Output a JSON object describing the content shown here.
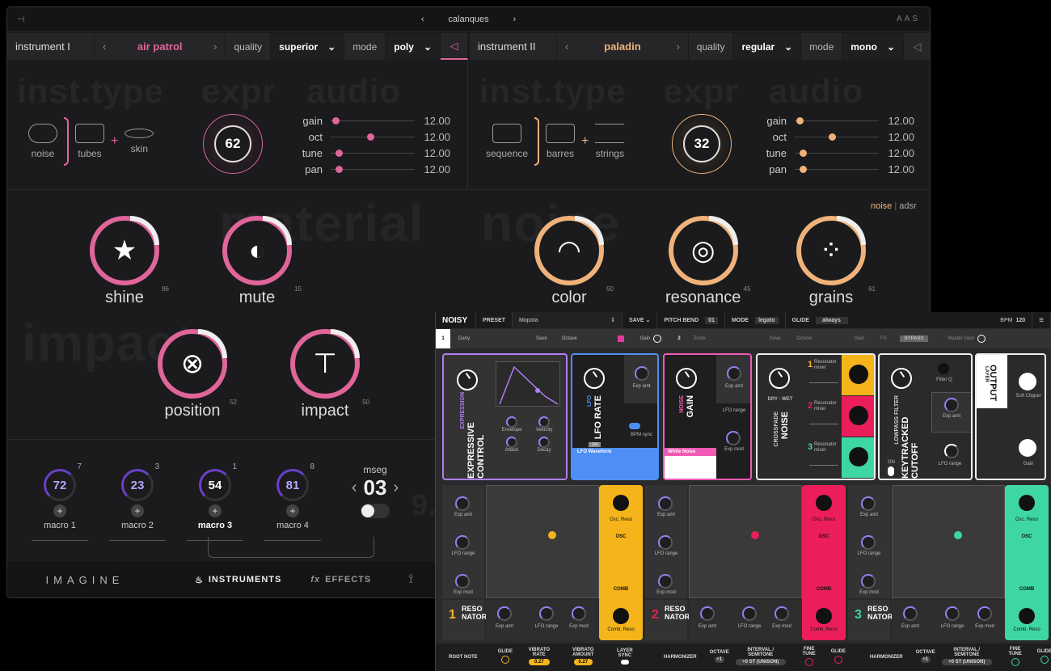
{
  "imagine": {
    "header": {
      "left_icon": "tune-icon",
      "prev": "‹",
      "preset_name": "calanques",
      "next": "›",
      "brand": "AAS"
    },
    "left": {
      "instrument": "instrument I",
      "preset": "air patrol",
      "quality_label": "quality",
      "quality": "superior",
      "mode_label": "mode",
      "mode": "poly",
      "accent": "#e0659a",
      "ghost": {
        "inst": "inst.type",
        "expr": "expr",
        "audio": "audio",
        "material": "material",
        "impact": "impact"
      },
      "types": [
        "noise",
        "tubes",
        "skin"
      ],
      "expr_value": "62",
      "sliders": [
        {
          "name": "gain",
          "value": "12.00",
          "pos": 0.02
        },
        {
          "name": "oct",
          "value": "12.00",
          "pos": 0.43
        },
        {
          "name": "tune",
          "value": "12.00",
          "pos": 0.06
        },
        {
          "name": "pan",
          "value": "12.00",
          "pos": 0.06
        }
      ],
      "knobs": [
        {
          "label": "shine",
          "num": "86",
          "icon": "star-icon",
          "glyph": "★"
        },
        {
          "label": "mute",
          "num": "15",
          "icon": "mute-circles-icon",
          "glyph": "◐"
        },
        {
          "label": "position",
          "num": "52",
          "icon": "drum-icon",
          "glyph": "⊗"
        },
        {
          "label": "impact",
          "num": "50",
          "icon": "mallet-icon",
          "glyph": "⊤"
        }
      ]
    },
    "right": {
      "instrument": "instrument II",
      "preset": "paladin",
      "quality_label": "quality",
      "quality": "regular",
      "mode_label": "mode",
      "mode": "mono",
      "accent": "#f0b27a",
      "ghost": {
        "inst": "inst.type",
        "expr": "expr",
        "audio": "audio",
        "noise": "noise"
      },
      "types": [
        "sequence",
        "barres",
        "strings"
      ],
      "expr_value": "32",
      "sliders": [
        {
          "name": "gain",
          "value": "12.00",
          "pos": 0.02
        },
        {
          "name": "oct",
          "value": "12.00",
          "pos": 0.4
        },
        {
          "name": "tune",
          "value": "12.00",
          "pos": 0.06
        },
        {
          "name": "pan",
          "value": "12.00",
          "pos": 0.06
        }
      ],
      "noise_tab": "noise",
      "adsr_tab": "adsr",
      "knobs": [
        {
          "label": "color",
          "num": "50",
          "icon": "rainbow-icon",
          "glyph": "◠"
        },
        {
          "label": "resonance",
          "num": "45",
          "icon": "ripple-icon",
          "glyph": "◎"
        },
        {
          "label": "grains",
          "num": "61",
          "icon": "grain-dots-icon",
          "glyph": "⁘"
        }
      ]
    },
    "macros": [
      {
        "value": "72",
        "label": "macro 1",
        "sup": "7"
      },
      {
        "value": "23",
        "label": "macro 2",
        "sup": "3"
      },
      {
        "value": "54",
        "label": "macro 3",
        "sup": "1"
      },
      {
        "value": "81",
        "label": "macro 4",
        "sup": "8"
      }
    ],
    "mseg": {
      "label": "mseg",
      "value": "03",
      "ghost": "9."
    },
    "footer": {
      "logo": "IMAGINE",
      "instruments": "INSTRUMENTS",
      "effects": "EFFECTS"
    }
  },
  "noisy": {
    "top": {
      "logo": "NOISY",
      "preset_label": "PRESET",
      "preset": "Mopota",
      "save": "SAVE",
      "pitch_label": "PITCH BEND",
      "pitch": "01",
      "mode_label": "MODE",
      "mode": "legato",
      "glide_label": "GLIDE",
      "glide": "always",
      "bpm_label": "BPM",
      "bpm": "120"
    },
    "layer1": {
      "num": "1",
      "name": "Dany",
      "save": "Save",
      "octave": "Octave",
      "gain": "Gain",
      "fx": "FX"
    },
    "layer2": {
      "num": "2",
      "name": "Zcrex",
      "save": "Save",
      "octave": "Octave",
      "gain": "Gain",
      "fx": "FX",
      "bypass": "BYPASS",
      "master": "Master Gain"
    },
    "expressive": {
      "small": "EXPRESSION",
      "title": "EXPRESSIVE CONTROL",
      "knobs": [
        "Envelope",
        "Velocity",
        "Attack",
        "Decay"
      ]
    },
    "lfo": {
      "small": "LFO",
      "title": "LFO RATE",
      "exp": "Exp amt",
      "bpm": "BPM sync",
      "value": "1/4",
      "wave": "LFO Waveform"
    },
    "noise": {
      "small": "NOISE",
      "title": "GAIN",
      "exp": "Exp amt",
      "range": "LFO range",
      "mod": "Exp mod",
      "wave": "White Noise"
    },
    "crossfade": {
      "small": "CROSSFADE",
      "title": "NOISE",
      "dw": "DRY - WET",
      "mixers": [
        "Resonator mixer",
        "Resonator mixer",
        "Resonator mixer"
      ]
    },
    "filter": {
      "small": "LOWPASS FILTER",
      "title": "KEYTRACKED CUTOFF",
      "q": "Filter Q",
      "exp": "Exp amt",
      "range": "LFO range",
      "mod": "Exp mod",
      "on": "ON"
    },
    "output": {
      "small": "LAYER",
      "title": "OUTPUT",
      "clip": "Soft Clipper",
      "gain": "Gain"
    },
    "resonators": [
      {
        "num": "1",
        "label": "RESO NATOR",
        "color": "#f5b41a",
        "osc": "Osc. Reso",
        "comb": "Comb. Reso",
        "osc_tag": "OSC",
        "comb_tag": "COMB"
      },
      {
        "num": "2",
        "label": "RESO NATOR",
        "color": "#ec1e5a",
        "osc": "Osc. Reso",
        "comb": "Comb. Reso",
        "osc_tag": "OSC",
        "comb_tag": "COMB"
      },
      {
        "num": "3",
        "label": "RESO NATOR",
        "color": "#3fd6a5",
        "osc": "Osc. Reso",
        "comb": "Comb. Reso",
        "osc_tag": "OSC",
        "comb_tag": "COMB"
      }
    ],
    "small_labels": {
      "exp": "Exp amt",
      "range": "LFO range",
      "mod": "Exp mod"
    },
    "bottom": {
      "root": "ROOT NOTE",
      "glide": "GLIDE",
      "vrate": "VIBRATO RATE",
      "vamt": "VIBRATO AMOUNT",
      "lsync": "LAYER SYNC",
      "vrate_v": "0.27",
      "vamt_v": "0.27",
      "harm": "HARMONIZER",
      "octave": "OCTAVE",
      "interval": "INTERVAL / SEMITONE",
      "fine": "FINE TUNE",
      "oct_v": "+1",
      "int_v": "+0 ST (UNISON)"
    }
  }
}
